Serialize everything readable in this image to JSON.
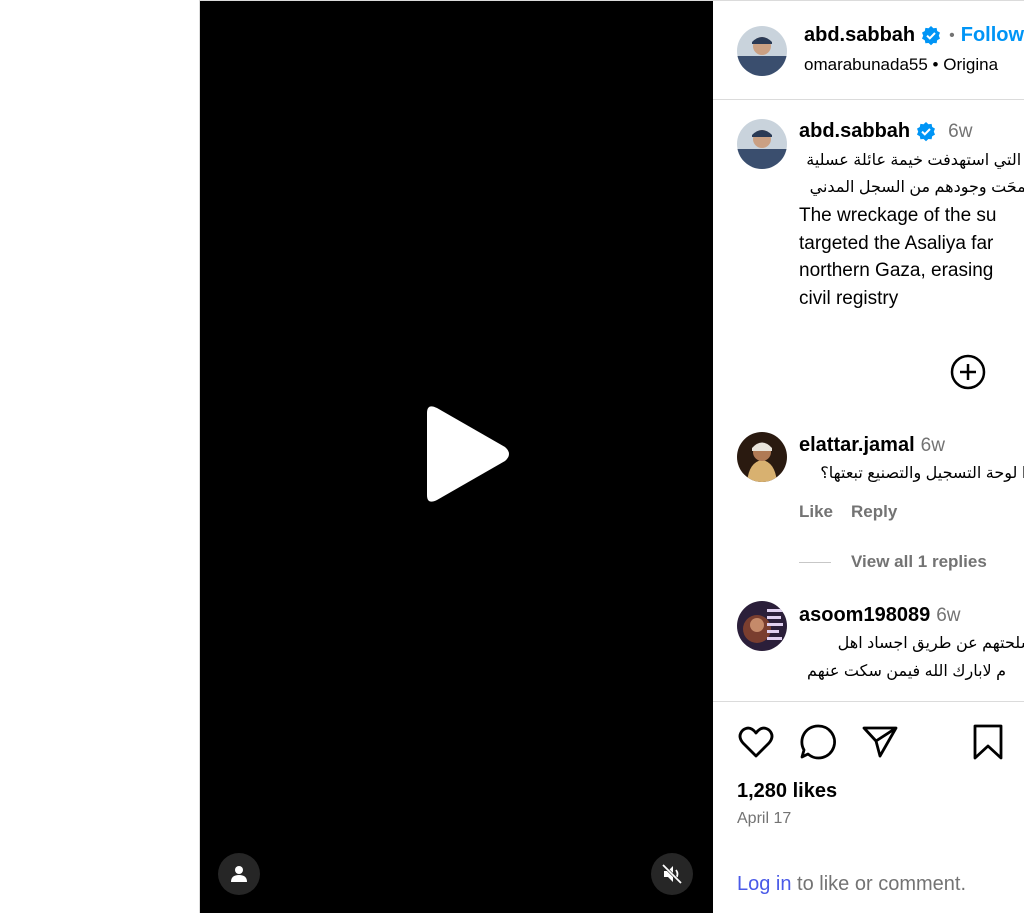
{
  "post": {
    "username": "abd.sabbah",
    "follow_label": "Follow",
    "dot": "•",
    "subtitle": "omarabunada55 • Origina",
    "time": "6w",
    "caption_ar_1": "ة التي استهدفت خيمة عائلة عسلية",
    "caption_ar_2": "فمحَت وجودهم من السجل المدني",
    "caption_en": "The wreckage of the su\ntargeted the Asaliya far\nnorthern Gaza, erasing\ncivil registry",
    "likes": "1,280 likes",
    "date": "April 17"
  },
  "comments": [
    {
      "username": "elattar.jamal",
      "time": "6w",
      "text_1": "را لوحة التسجيل والتصنيع تبعتها؟",
      "like": "Like",
      "reply": "Reply"
    },
    {
      "username": "asoom198089",
      "time": "6w",
      "text_1": "سلحتهم عن طريق اجساد اهل",
      "text_2": "م لابارك الله فيمن سكت عنهم"
    }
  ],
  "view_replies": "View all 1 replies",
  "login": {
    "link": "Log in",
    "rest": " to like or comment."
  },
  "colors": {
    "accent": "#0095f6",
    "verified": "#0095f6",
    "link": "#4a5ae8",
    "muted": "#737373"
  },
  "icons": [
    "play-icon",
    "user-icon",
    "muted-speaker-icon",
    "verified-badge-icon",
    "add-circle-icon",
    "heart-icon",
    "comment-icon",
    "share-icon",
    "bookmark-icon"
  ]
}
